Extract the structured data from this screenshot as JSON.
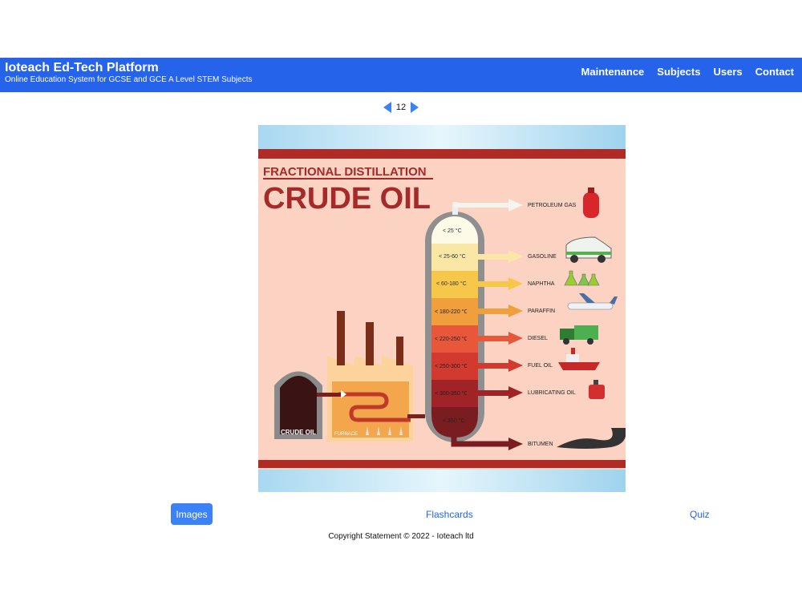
{
  "header": {
    "title": "Ioteach Ed-Tech Platform",
    "subtitle": "Online Education System for GCSE and GCE A Level STEM Subjects",
    "nav": [
      "Maintenance",
      "Subjects",
      "Users",
      "Contact"
    ]
  },
  "pager": {
    "page": "12"
  },
  "figure": {
    "heading_top": "FRACTIONAL DISTILLATION",
    "heading_main": "CRUDE OIL",
    "crude_label": "CRUDE OIL",
    "furnace_label": "FURNACE",
    "fractions": [
      {
        "temp": "< 25 °C",
        "product": "PETROLEUM GAS"
      },
      {
        "temp": "< 25-60 °C",
        "product": "GASOLINE"
      },
      {
        "temp": "< 60-180 °C",
        "product": "NAPHTHA"
      },
      {
        "temp": "< 180-220 °C",
        "product": "PARAFFIN"
      },
      {
        "temp": "< 220-250 °C",
        "product": "DIESEL"
      },
      {
        "temp": "< 250-300 °C",
        "product": "FUEL OIL"
      },
      {
        "temp": "< 300-350 °C",
        "product": "LUBRICATING OIL"
      },
      {
        "temp": "< 350 °C",
        "product": "BITUMEN"
      }
    ]
  },
  "tabs": {
    "images": "Images",
    "flashcards": "Flashcards",
    "quiz": "Quiz"
  },
  "footer": {
    "copyright": "Copyright Statement © 2022 - Ioteach ltd"
  },
  "colors": {
    "header_bg": "#2563eb",
    "active_tab": "#3b82f6",
    "link": "#2563eb",
    "title_red": "#a52a2a"
  }
}
